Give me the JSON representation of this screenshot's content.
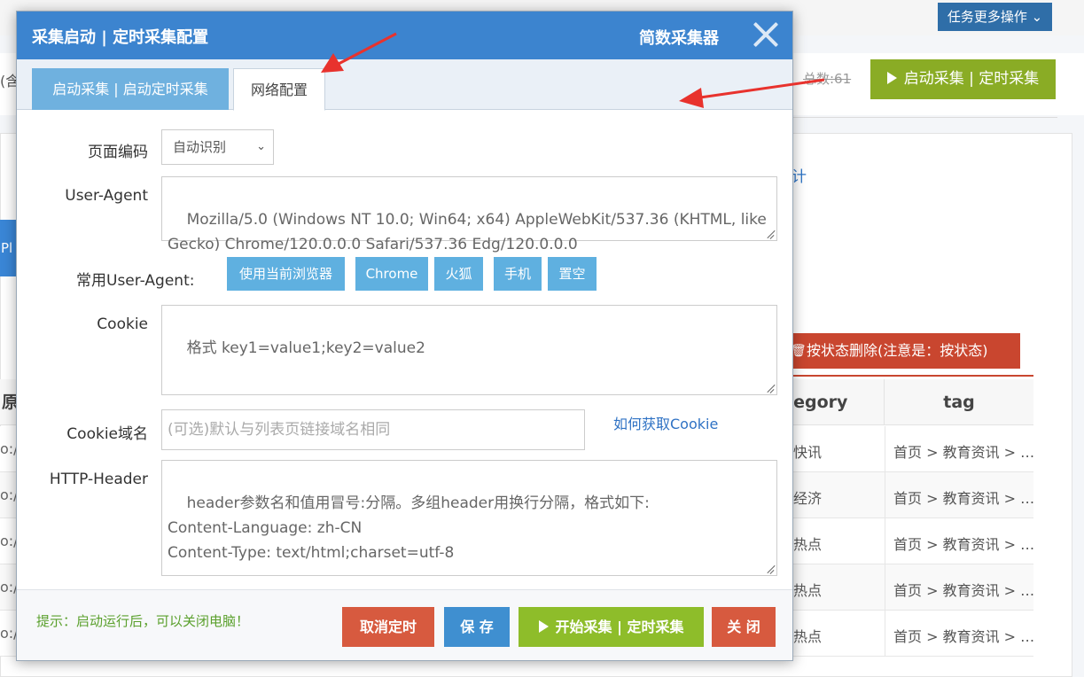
{
  "background": {
    "task_menu": "任务更多操作",
    "left_fragment": "(含",
    "total": "总数:61",
    "start_button": "启动采集 | 定时采集",
    "stat_fragment": "计",
    "left_tab_fragment": "Pl",
    "delete_button": "按状态删除(注意是：按状态)",
    "columns": {
      "orig": "原",
      "category": "tegory",
      "tag": "tag"
    },
    "rows": [
      {
        "left": "o://",
        "category": "快讯",
        "tag": "首页 > 教育资讯 > …"
      },
      {
        "left": "o://",
        "category": "经济",
        "tag": "首页 > 教育资讯 > …"
      },
      {
        "left": "o://",
        "category": "热点",
        "tag": "首页 > 教育资讯 > …"
      },
      {
        "left": "o://",
        "category": "热点",
        "tag": "首页 > 教育资讯 > …"
      },
      {
        "left": "o://",
        "category": "热点",
        "tag": "首页 > 教育资讯 > …"
      }
    ]
  },
  "modal": {
    "title": "采集启动 | 定时采集配置",
    "brand": "简数采集器",
    "tabs": [
      {
        "label": "启动采集 | 启动定时采集",
        "active": false
      },
      {
        "label": "网络配置",
        "active": true
      }
    ],
    "encoding": {
      "label": "页面编码",
      "value": "自动识别"
    },
    "user_agent": {
      "label": "User-Agent",
      "value": "Mozilla/5.0 (Windows NT 10.0; Win64; x64) AppleWebKit/537.36 (KHTML, like Gecko) Chrome/120.0.0.0 Safari/537.36 Edg/120.0.0.0"
    },
    "common_ua": {
      "label": "常用User-Agent:",
      "buttons": [
        "使用当前浏览器",
        "Chrome",
        "火狐",
        "手机",
        "置空"
      ]
    },
    "cookie": {
      "label": "Cookie",
      "placeholder": "格式 key1=value1;key2=value2"
    },
    "cookie_domain": {
      "label": "Cookie域名",
      "placeholder": "(可选)默认与列表页链接域名相同",
      "help_link": "如何获取Cookie"
    },
    "http_header": {
      "label": "HTTP-Header",
      "placeholder": "header参数名和值用冒号:分隔。多组header用换行分隔，格式如下:\nContent-Language: zh-CN\nContent-Type: text/html;charset=utf-8"
    },
    "footer": {
      "hint": "提示：启动运行后，可以关闭电脑！",
      "cancel_schedule": "取消定时",
      "save": "保 存",
      "start": "开始采集 | 定时采集",
      "close": "关 闭"
    }
  },
  "colors": {
    "header": "#3c84cf",
    "tab_active_bg": "#ffffff",
    "tab_inactive_bg": "#6fb1df",
    "ua_button": "#5fb0e0",
    "danger": "#d75a3f",
    "primary": "#3f8fd0",
    "success": "#8ebd2a",
    "annotation_arrow": "#e8322d"
  }
}
